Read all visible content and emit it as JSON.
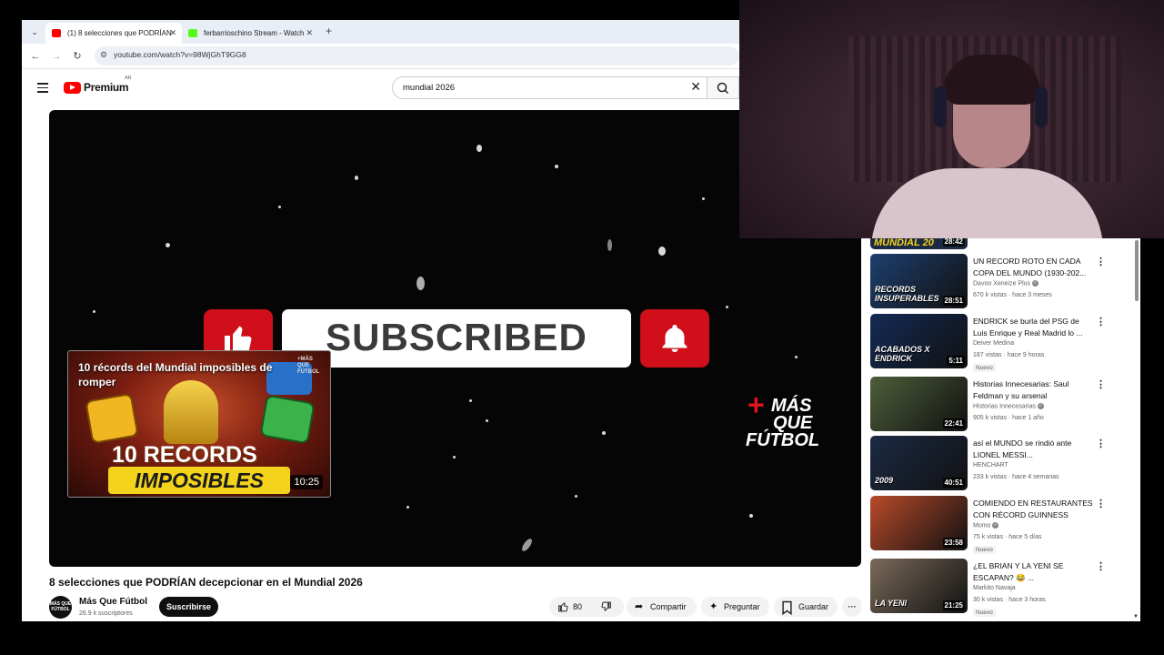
{
  "browser": {
    "tabs": [
      {
        "title": "(1) 8 selecciones que PODRÍAN",
        "active": true,
        "favicon_color": "#ff0000"
      },
      {
        "title": "ferbarrioschino Stream - Watch",
        "active": false,
        "favicon_color": "#53fc18"
      }
    ],
    "new_tab": "+",
    "url": "youtube.com/watch?v=98WjGhT9GG8"
  },
  "youtube": {
    "logo_text": "Premium",
    "country_code": "AR",
    "search_query": "mundial 2026"
  },
  "player": {
    "overlay_subscribed": "SUBSCRIBED",
    "brand_line1": "MÁS",
    "brand_line2": "QUE",
    "brand_line3": "FÚTBOL",
    "brand_plus": "+",
    "endcard": {
      "title": "10 récords del Mundial imposibles de romper",
      "big_line1": "10 RECORDS",
      "big_line2": "IMPOSIBLES",
      "duration": "10:25",
      "mini_brand": "+MÁS QUE FÚTBOL"
    }
  },
  "video": {
    "title": "8 selecciones que PODRÍAN decepcionar en el Mundial 2026",
    "channel_name": "Más Que Fútbol",
    "channel_avatar_text": "MÁS QUE FÚTBOL",
    "subscribers": "26.9 k suscriptores",
    "subscribe_label": "Suscribirse",
    "likes": "80",
    "share_label": "Compartir",
    "ask_label": "Preguntar",
    "save_label": "Guardar",
    "more_label": "···"
  },
  "recommendations": [
    {
      "title": "UN RECORD ROTO EN CADA COPA DEL MUNDO (1930-202...",
      "channel": "Davoo Xeneize Plus",
      "verified": true,
      "meta": "670 k vistas · hace 3 meses",
      "duration": "28:51",
      "badge": "",
      "thumb_text": "RECORDS INSUPERABLES",
      "thumb_color": "#1d3f6e"
    },
    {
      "title": "ENDRICK se burla del PSG de Luis Enrique y Real Madrid lo ...",
      "channel": "Deiver Medina",
      "verified": false,
      "meta": "187 vistas · hace 9 horas",
      "duration": "5:11",
      "badge": "Nuevo",
      "thumb_text": "ACABADOS X ENDRICK",
      "thumb_color": "#142a55"
    },
    {
      "title": "Historias Innecesarias: Saul Feldman y su arsenal",
      "channel": "Historias Innecesarias",
      "verified": true,
      "meta": "905 k vistas · hace 1 año",
      "duration": "22:41",
      "badge": "",
      "thumb_text": "",
      "thumb_color": "#4d5e3a"
    },
    {
      "title": "así el MUNDO se rindió ante LIONEL MESSI...",
      "channel": "HENCHART",
      "verified": false,
      "meta": "233 k vistas · hace 4 semanas",
      "duration": "40:51",
      "badge": "",
      "thumb_text": "2009",
      "thumb_color": "#1c2a44"
    },
    {
      "title": "COMIENDO EN RESTAURANTES CON RÉCORD GUINNESS",
      "channel": "Momo",
      "verified": true,
      "meta": "75 k vistas · hace 5 días",
      "duration": "23:58",
      "badge": "Nuevo",
      "thumb_text": "",
      "thumb_color": "#b84a2a"
    },
    {
      "title": "¿EL BRIAN Y LA YENI SE ESCAPAN? 😂 ...",
      "channel": "Markito Navaja",
      "verified": false,
      "meta": "30 k vistas · hace 3 horas",
      "duration": "21:25",
      "badge": "Nuevo",
      "thumb_text": "LA YENI",
      "thumb_color": "#7a6a5a"
    }
  ],
  "sidebar_top_partial": {
    "text": "MUNDIAL 20",
    "duration": "28:42"
  },
  "colors": {
    "youtube_red": "#ff0000",
    "overlay_red": "#d10f1a",
    "brand_red": "#e0141c"
  }
}
